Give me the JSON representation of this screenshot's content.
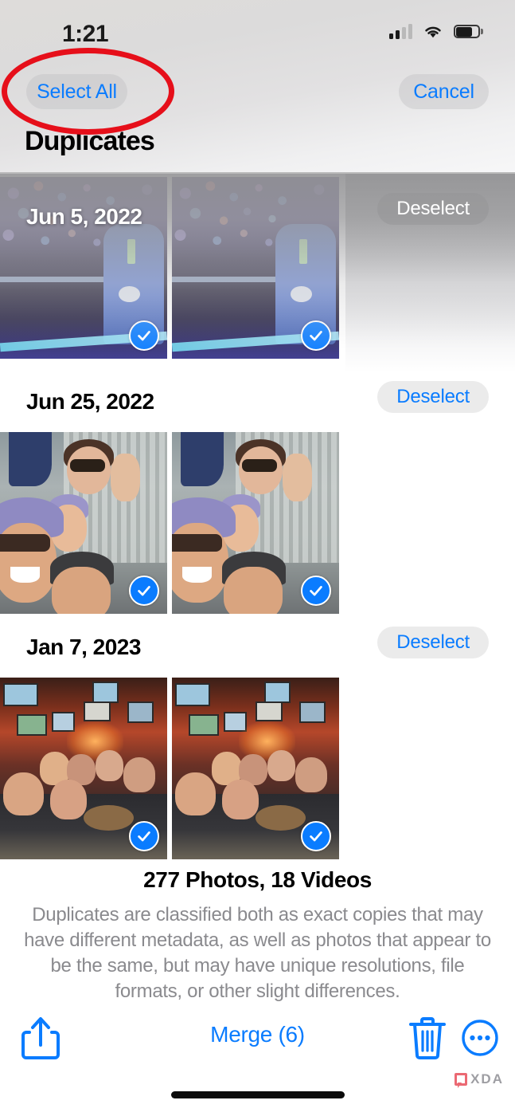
{
  "status_bar": {
    "time": "1:21",
    "signal_icon": "cellular-signal-icon",
    "signal_bars_filled": 2,
    "signal_bars_total": 4,
    "wifi_icon": "wifi-icon",
    "battery_icon": "battery-icon"
  },
  "header": {
    "select_all_label": "Select All",
    "cancel_label": "Cancel",
    "title": "Duplicates",
    "annotation": {
      "shape": "ellipse",
      "color": "#e60f1a",
      "target": "Select All"
    }
  },
  "groups": [
    {
      "date": "Jun 5, 2022",
      "action_label": "Deselect",
      "photos": [
        {
          "alt": "Man in blue suit in front of concert crowd",
          "selected": true
        },
        {
          "alt": "Man in blue suit in front of concert crowd (duplicate)",
          "selected": true
        }
      ]
    },
    {
      "date": "Jun 25, 2022",
      "action_label": "Deselect",
      "photos": [
        {
          "alt": "Family selfie on deck",
          "selected": true
        },
        {
          "alt": "Family selfie on deck (duplicate)",
          "selected": true
        }
      ]
    },
    {
      "date": "Jan 7, 2023",
      "action_label": "Deselect",
      "photos": [
        {
          "alt": "Group of friends at a sports bar",
          "selected": true
        },
        {
          "alt": "Group of friends at a sports bar (duplicate)",
          "selected": true
        }
      ]
    }
  ],
  "info": {
    "count": "277 Photos, 18 Videos",
    "description": "Duplicates are classified both as exact copies that may have different metadata, as well as photos that appear to be the same, but may have unique resolutions, file formats, or other slight differences."
  },
  "toolbar": {
    "share_icon": "share-icon",
    "merge_label": "Merge (6)",
    "trash_icon": "trash-icon",
    "more_icon": "more-ellipsis-icon"
  },
  "watermark": {
    "text": "XDA"
  },
  "colors": {
    "accent_blue": "#0a7cff",
    "annotation_red": "#e60f1a",
    "secondary_text": "#8a8a8e"
  }
}
